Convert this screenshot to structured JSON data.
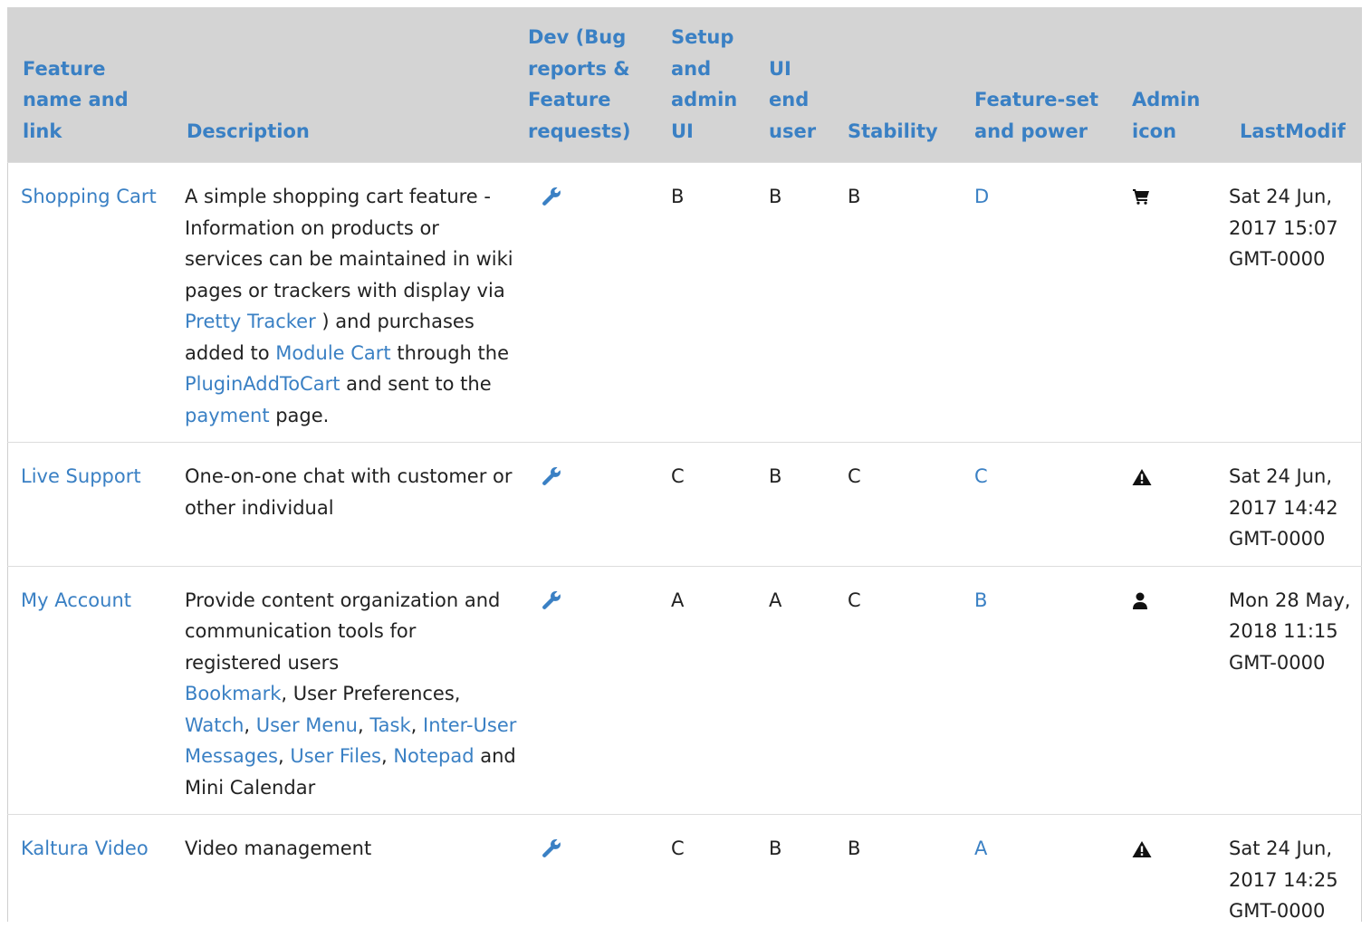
{
  "headers": {
    "feature": "Feature name and link",
    "description": "Description",
    "dev": "Dev (Bug reports & Feature requests)",
    "setup": "Setup and admin UI",
    "ui": "UI end user",
    "stability": "Stability",
    "featureset": "Feature-set and power",
    "admin_icon": "Admin icon",
    "lastmodif": "LastModif"
  },
  "rows": [
    {
      "name": "Shopping Cart",
      "desc": {
        "t1": "A simple shopping cart feature - Information on products or services can be maintained in wiki pages or trackers with display via ",
        "l1": "Pretty Tracker",
        "t2": " ) and purchases added to ",
        "l2": "Module Cart",
        "t3": " through the ",
        "l3": "PluginAddToCart",
        "t4": " and sent to the ",
        "l4": "payment",
        "t5": " page."
      },
      "dev_icon": "wrench-icon",
      "setup": "B",
      "ui": "B",
      "stability": "B",
      "featureset": "D",
      "admin_icon": "shopping-cart-icon",
      "lastmodif": "Sat 24 Jun, 2017 15:07 GMT-0000"
    },
    {
      "name": "Live Support",
      "desc": {
        "t1": "One-on-one chat with customer or other individual"
      },
      "dev_icon": "wrench-icon",
      "setup": "C",
      "ui": "B",
      "stability": "C",
      "featureset": "C",
      "admin_icon": "warning-icon",
      "lastmodif": "Sat 24 Jun, 2017 14:42 GMT-0000"
    },
    {
      "name": "My Account",
      "desc": {
        "t1": "Provide content organization and communication tools for registered users",
        "l1": "Bookmark",
        "t2": ", User Preferences, ",
        "l2": "Watch",
        "t3": ", ",
        "l3": "User Menu",
        "t4": ", ",
        "l4": "Task",
        "t5": ", ",
        "l5": "Inter-User Messages",
        "t6": ", ",
        "l6": "User Files",
        "t7": ", ",
        "l7": "Notepad",
        "t8": " and Mini Calendar"
      },
      "dev_icon": "wrench-icon",
      "setup": "A",
      "ui": "A",
      "stability": "C",
      "featureset": "B",
      "admin_icon": "user-icon",
      "lastmodif": "Mon 28 May, 2018 11:15 GMT-0000"
    },
    {
      "name": "Kaltura Video",
      "desc": {
        "t1": "Video management"
      },
      "dev_icon": "wrench-icon",
      "setup": "C",
      "ui": "B",
      "stability": "B",
      "featureset": "A",
      "admin_icon": "warning-icon",
      "lastmodif": "Sat 24 Jun, 2017 14:25 GMT-0000"
    }
  ]
}
